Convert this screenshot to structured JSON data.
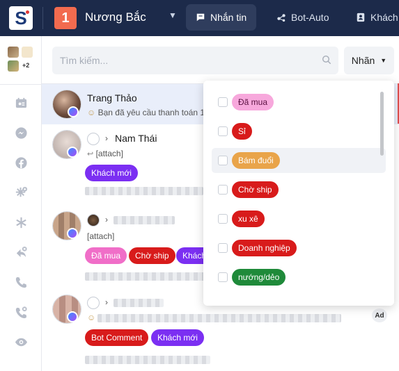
{
  "topbar": {
    "logo_letter": "S",
    "page_number": "1",
    "page_name": "Nương Bắc",
    "tabs": [
      {
        "label": "Nhắn tin",
        "icon": "chat-icon",
        "active": true
      },
      {
        "label": "Bot-Auto",
        "icon": "bot-icon",
        "active": false
      },
      {
        "label": "Khách",
        "icon": "contact-icon",
        "active": false
      }
    ]
  },
  "sidebar": {
    "account_badge": "+2",
    "icons": [
      "calendar-icon",
      "messenger-icon",
      "facebook-icon",
      "star-add-icon",
      "asterisk-icon",
      "reply-remove-icon",
      "phone-icon",
      "phone-missed-icon",
      "eye-icon"
    ]
  },
  "search": {
    "placeholder": "Tìm kiếm..."
  },
  "label_filter": {
    "label": "Nhãn"
  },
  "conversations": [
    {
      "name": "Trang Thảo",
      "preview": "Bạn đã yêu cầu thanh toán 1",
      "tags": []
    },
    {
      "name": "Nam Thái",
      "preview": "[attach]",
      "tags": [
        {
          "label": "Khách mới",
          "color": "#7b2ff2"
        }
      ]
    },
    {
      "name": "",
      "preview": "[attach]",
      "tags": [
        {
          "label": "Đã mua",
          "color": "#f06ec8"
        },
        {
          "label": "Chờ ship",
          "color": "#d81b1b"
        },
        {
          "label": "Khách",
          "color": "#7b2ff2"
        }
      ]
    },
    {
      "name": "",
      "preview": "",
      "tags": [
        {
          "label": "Bot Comment",
          "color": "#d81b1b"
        },
        {
          "label": "Khách mới",
          "color": "#7b2ff2"
        }
      ],
      "badge": "Ad"
    }
  ],
  "dropdown": {
    "items": [
      {
        "label": "Đã mua",
        "bg": "#f7a8dc",
        "fg": "#5a1040"
      },
      {
        "label": "Sỉ",
        "bg": "#d81b1b",
        "fg": "#ffffff"
      },
      {
        "label": "Bám đuổi",
        "bg": "#e9a44a",
        "fg": "#ffffff"
      },
      {
        "label": "Chờ ship",
        "bg": "#d81b1b",
        "fg": "#ffffff"
      },
      {
        "label": "xu xê",
        "bg": "#d81b1b",
        "fg": "#ffffff"
      },
      {
        "label": "Doanh nghiệp",
        "bg": "#d81b1b",
        "fg": "#ffffff"
      },
      {
        "label": "nướng/dẻo",
        "bg": "#1f8a3a",
        "fg": "#ffffff"
      }
    ],
    "highlighted_index": 2
  }
}
